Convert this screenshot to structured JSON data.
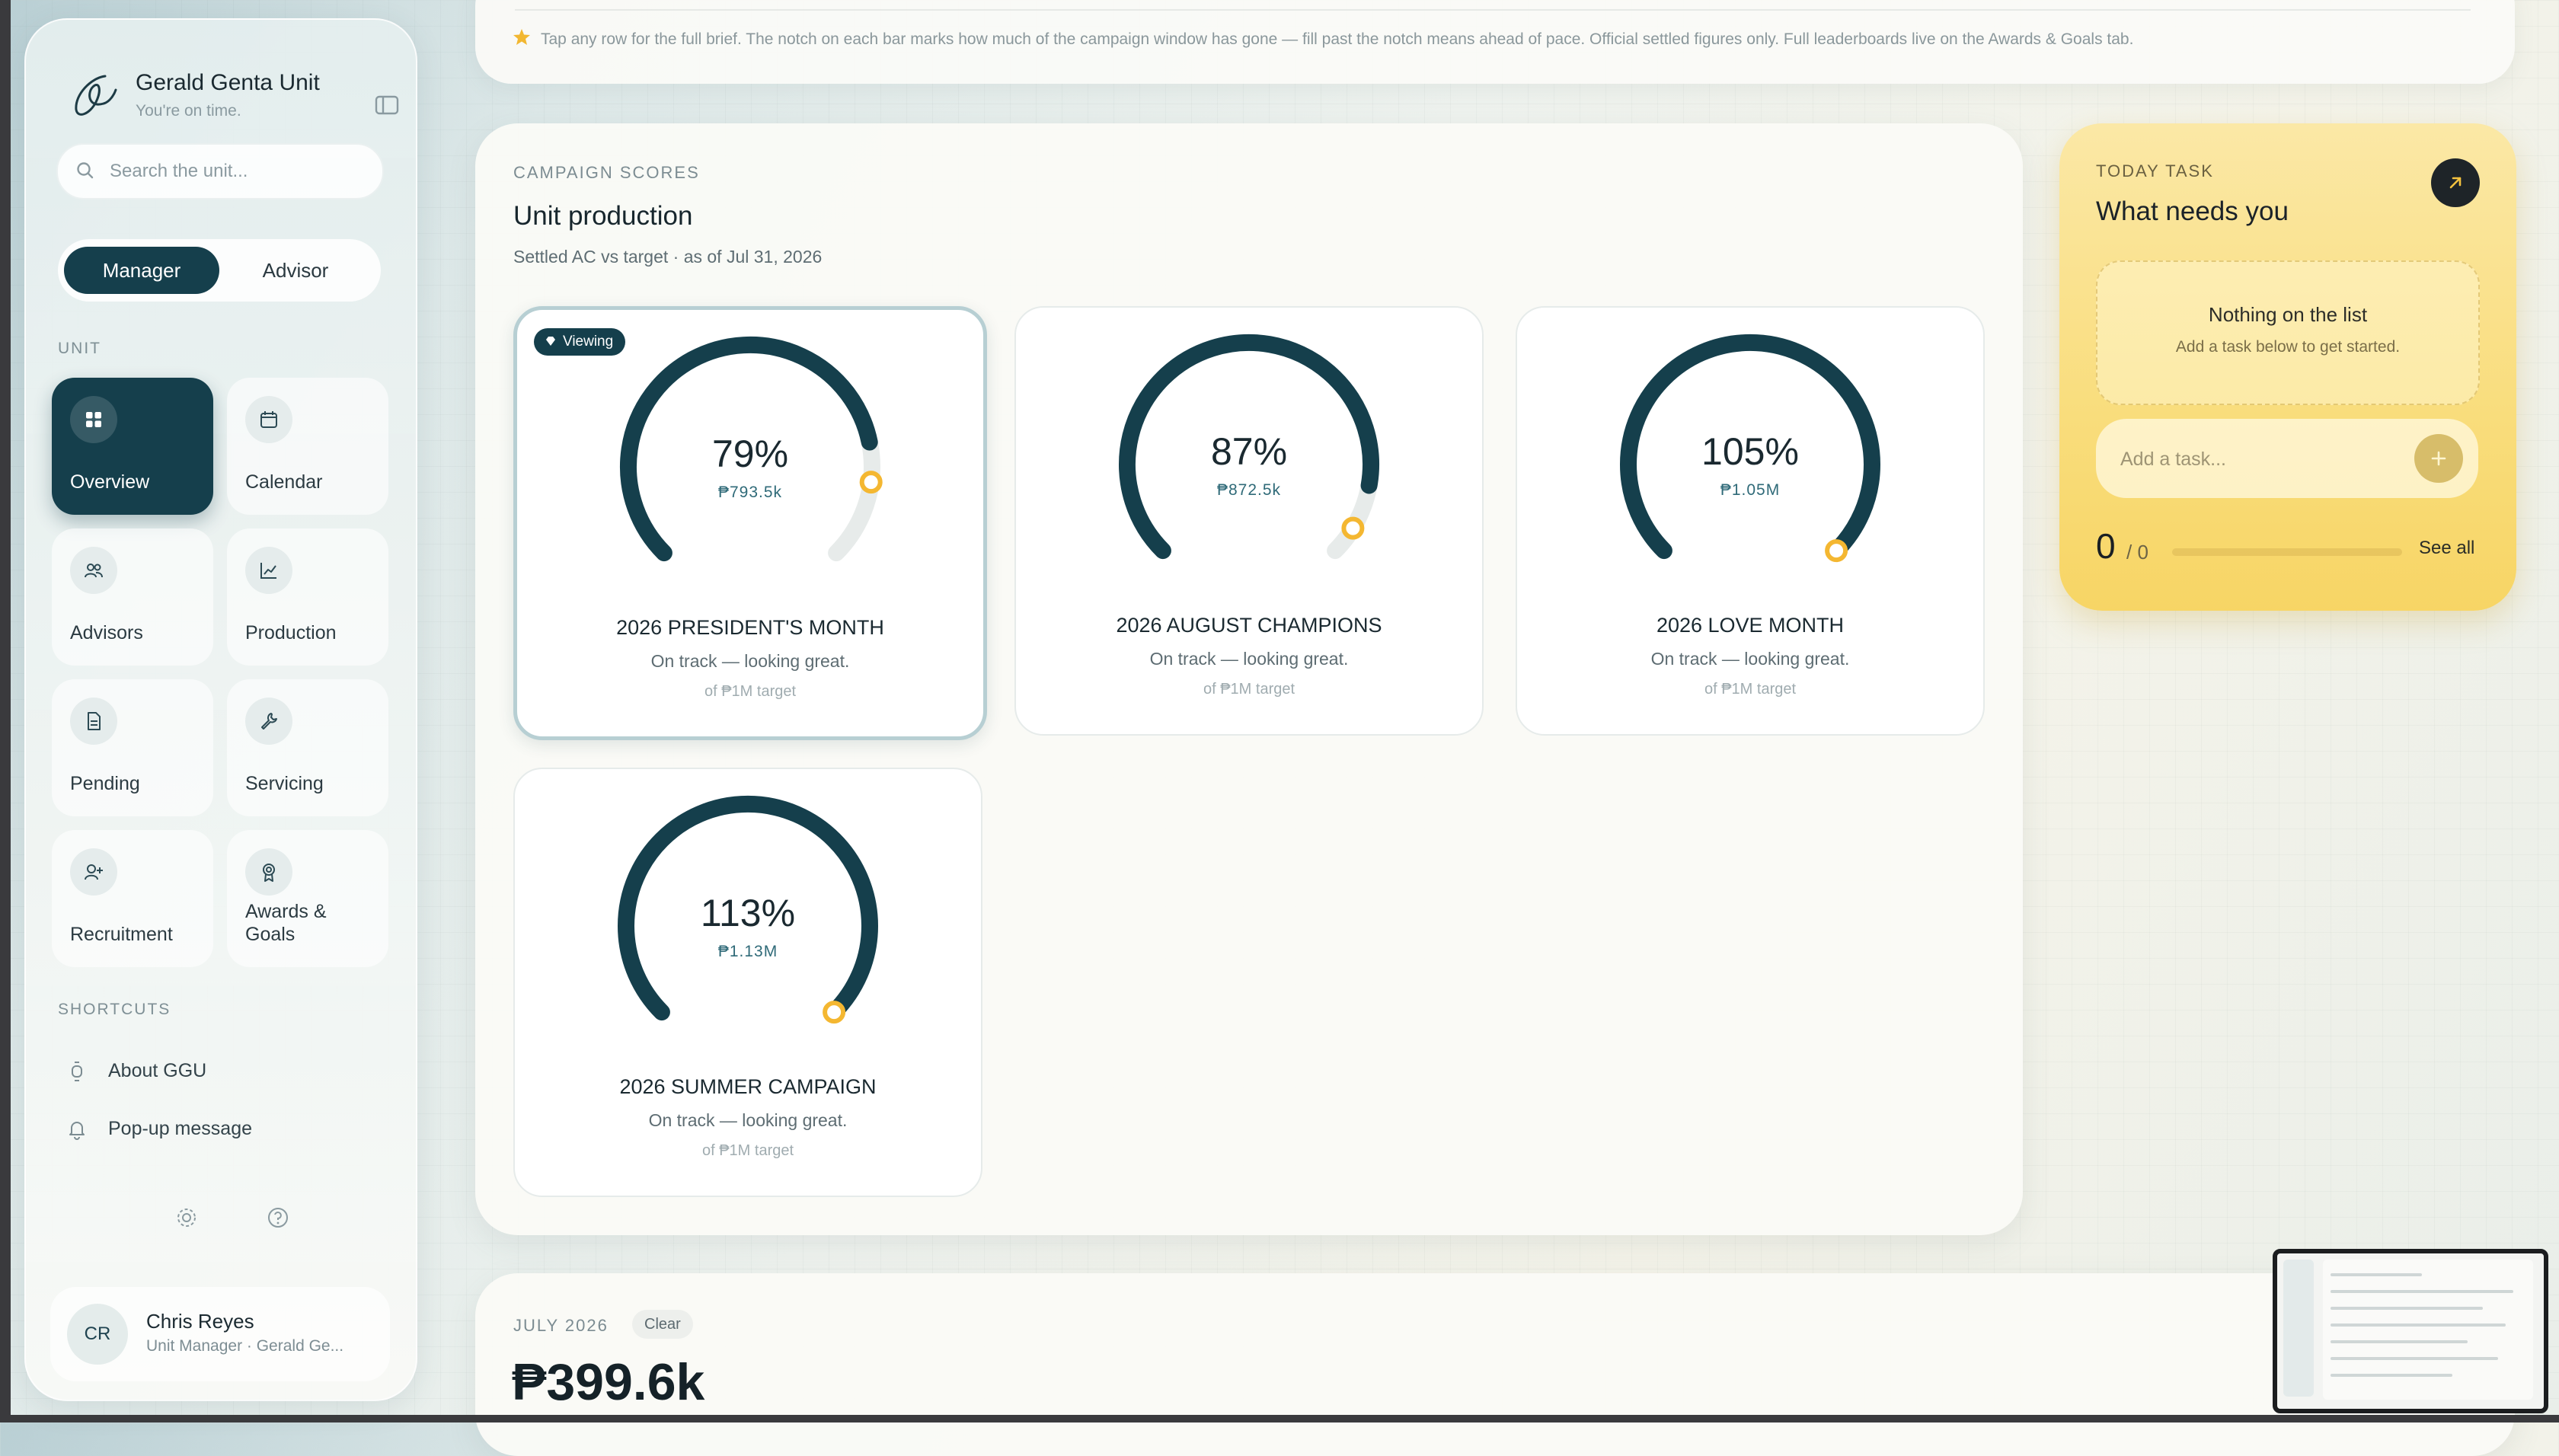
{
  "brand": {
    "name": "Gerald Genta Unit",
    "tagline": "You're on time."
  },
  "search": {
    "placeholder": "Search the unit..."
  },
  "roles": {
    "active": "Manager",
    "other": "Advisor"
  },
  "nav": {
    "section": "UNIT",
    "items": [
      {
        "label": "Overview",
        "icon": "grid-icon"
      },
      {
        "label": "Calendar",
        "icon": "calendar-icon"
      },
      {
        "label": "Advisors",
        "icon": "users-icon"
      },
      {
        "label": "Production",
        "icon": "chart-icon"
      },
      {
        "label": "Pending",
        "icon": "document-icon"
      },
      {
        "label": "Servicing",
        "icon": "wrench-icon"
      },
      {
        "label": "Recruitment",
        "icon": "user-plus-icon"
      },
      {
        "label": "Awards & Goals",
        "icon": "award-icon"
      }
    ]
  },
  "shortcuts": {
    "section": "SHORTCUTS",
    "items": [
      {
        "label": "About GGU",
        "icon": "watch-icon"
      },
      {
        "label": "Pop-up message",
        "icon": "bell-icon"
      }
    ]
  },
  "user": {
    "initials": "CR",
    "name": "Chris Reyes",
    "role": "Unit Manager · Gerald Ge..."
  },
  "banner": {
    "text": "Tap any row for the full brief. The notch on each bar marks how much of the campaign window has gone — fill past the notch means ahead of pace. Official settled figures only. Full leaderboards live on the Awards & Goals tab."
  },
  "campaign": {
    "eyebrow": "CAMPAIGN SCORES",
    "title": "Unit production",
    "subtitle": "Settled AC vs target · as of Jul 31, 2026",
    "viewing_label": "Viewing",
    "gauges": [
      {
        "name": "2026 PRESIDENT'S MONTH",
        "percent_label": "79%",
        "percent": 79,
        "amount": "₱793.5k",
        "status": "On track — looking great.",
        "target": "of ₱1M target",
        "notch": 0.86,
        "viewing": true
      },
      {
        "name": "2026 AUGUST CHAMPIONS",
        "percent_label": "87%",
        "percent": 87,
        "amount": "₱872.5k",
        "status": "On track — looking great.",
        "target": "of ₱1M target",
        "notch": 0.95,
        "viewing": false
      },
      {
        "name": "2026 LOVE MONTH",
        "percent_label": "105%",
        "percent": 105,
        "amount": "₱1.05M",
        "status": "On track — looking great.",
        "target": "of ₱1M target",
        "notch": 1.0,
        "viewing": false
      },
      {
        "name": "2026 SUMMER CAMPAIGN",
        "percent_label": "113%",
        "percent": 113,
        "amount": "₱1.13M",
        "status": "On track — looking great.",
        "target": "of ₱1M target",
        "notch": 1.0,
        "viewing": false
      }
    ]
  },
  "task": {
    "eyebrow": "TODAY TASK",
    "title": "What needs you",
    "empty_title": "Nothing on the list",
    "empty_sub": "Add a task below to get started.",
    "input_placeholder": "Add a task...",
    "done": "0",
    "total": "/ 0",
    "progress": 0,
    "see_all": "See all"
  },
  "month": {
    "eyebrow": "JULY 2026",
    "chip": "Clear",
    "amount": "₱399.6k"
  },
  "colors": {
    "accent": "#153f4c",
    "notch": "#f4b731",
    "track": "#e7ebea",
    "task": "#f9dd7c"
  }
}
